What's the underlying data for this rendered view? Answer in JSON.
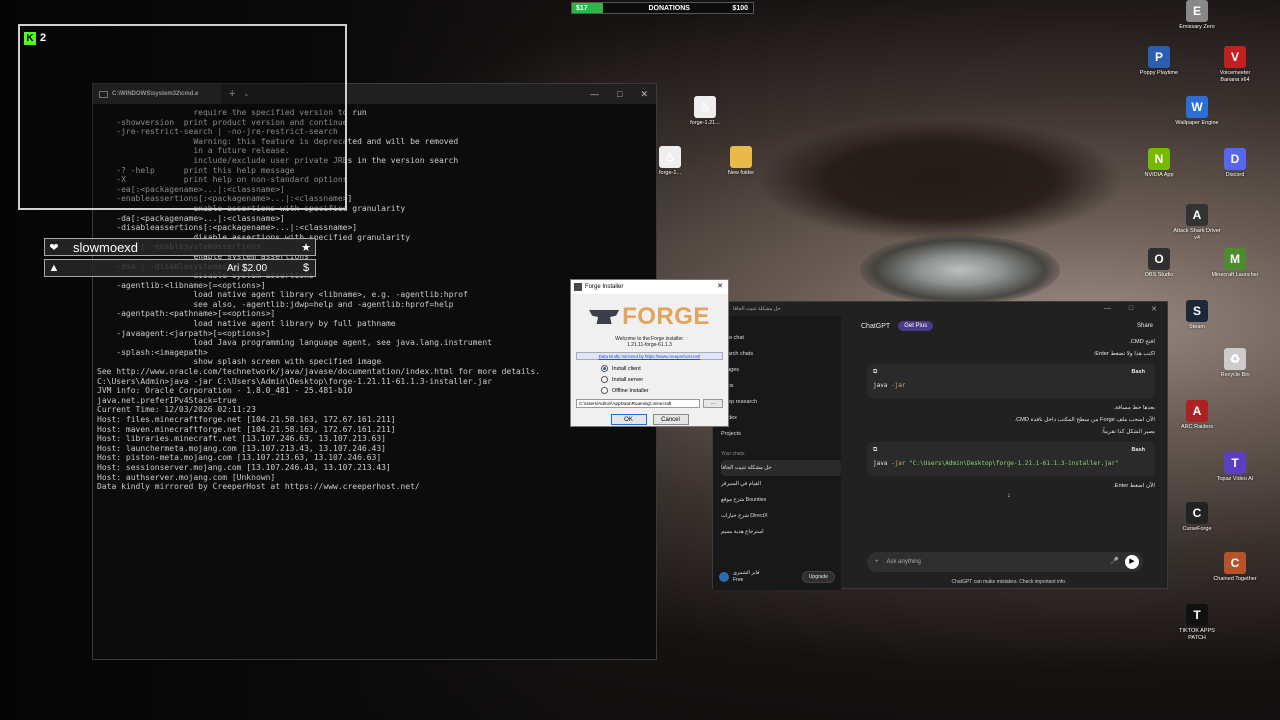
{
  "donation": {
    "current": "$17",
    "label": "DONATIONS",
    "goal": "$100",
    "progress": 0.17,
    "fill_color": "#2fb44a"
  },
  "kick": {
    "viewers": "2",
    "logo": "K"
  },
  "overlay_rows": [
    {
      "left_icon": "heart-icon",
      "text": "slowmoexd",
      "right_icon": "star-icon",
      "left_glyph": "❤",
      "right_glyph": "★"
    },
    {
      "left_icon": "drop-icon",
      "text": "Ari",
      "amount": "$2.00",
      "right_icon": "dollar-icon",
      "left_glyph": "▲",
      "right_glyph": "$"
    }
  ],
  "cmd": {
    "tab_title": "C:\\WINDOWS\\system32\\cmd.e",
    "plus": "+",
    "chevron": "⌄",
    "win_controls": [
      "—",
      "□",
      "✕"
    ],
    "lines": [
      "                    require the specified version to run",
      "    -showversion  print product version and continue",
      "    -jre-restrict-search | -no-jre-restrict-search",
      "                    Warning: this feature is deprecated and will be removed",
      "                    in a future release.",
      "                    include/exclude user private JREs in the version search",
      "    -? -help      print this help message",
      "    -X            print help on non-standard options",
      "    -ea[:<packagename>...|:<classname>]",
      "    -enableassertions[:<packagename>...|:<classname>]",
      "                    enable assertions with specified granularity",
      "    -da[:<packagename>...|:<classname>]",
      "    -disableassertions[:<packagename>...|:<classname>]",
      "                    disable assertions with specified granularity",
      "    -esa | -enablesystemassertions",
      "                    enable system assertions",
      "    -dsa | -disablesystemassertions",
      "                    disable system assertions",
      "    -agentlib:<libname>[=<options>]",
      "                    load native agent library <libname>, e.g. -agentlib:hprof",
      "                    see also, -agentlib:jdwp=help and -agentlib:hprof=help",
      "    -agentpath:<pathname>[=<options>]",
      "                    load native agent library by full pathname",
      "    -javaagent:<jarpath>[=<options>]",
      "                    load Java programming language agent, see java.lang.instrument",
      "    -splash:<imagepath>",
      "                    show splash screen with specified image",
      "See http://www.oracle.com/technetwork/java/javase/documentation/index.html for more details.",
      "",
      "C:\\Users\\Admin>java -jar C:\\Users\\Admin\\Desktop\\forge-1.21.11-61.1.3-installer.jar",
      "JVM info: Oracle Corporation - 1.8.0_481 - 25.481-b10",
      "java.net.preferIPv4Stack=true",
      "Current Time: 12/03/2026 02:11:23",
      "Host: files.minecraftforge.net [104.21.58.163, 172.67.161.211]",
      "Host: maven.minecraftforge.net [104.21.58.163, 172.67.161.211]",
      "Host: libraries.minecraft.net [13.107.246.63, 13.107.213.63]",
      "Host: launchermeta.mojang.com [13.107.213.43, 13.107.246.43]",
      "Host: piston-meta.mojang.com [13.107.213.63, 13.107.246.63]",
      "Host: sessionserver.mojang.com [13.107.246.43, 13.107.213.43]",
      "Host: authserver.mojang.com [Unknown]",
      "Data kindly mirrored by CreeperHost at https://www.creeperhost.net/"
    ]
  },
  "desktop_icons": [
    {
      "label": "Emissary Zero",
      "icon": "emissary-icon",
      "color": "#888",
      "glyph": "E"
    },
    {
      "label": "Poppy Playtime",
      "icon": "poppy-icon",
      "color": "#2a5fb0",
      "glyph": "P"
    },
    {
      "label": "Voicemeeter Banana x64",
      "icon": "voicemeeter-icon",
      "color": "#c02020",
      "glyph": "V"
    },
    {
      "label": "Wallpaper Engine",
      "icon": "wallpaper-engine-icon",
      "color": "#2c6ed5",
      "glyph": "W"
    },
    {
      "label": "NVIDIA App",
      "icon": "nvidia-icon",
      "color": "#76b900",
      "glyph": "N"
    },
    {
      "label": "Discord",
      "icon": "discord-icon",
      "color": "#5865f2",
      "glyph": "D"
    },
    {
      "label": "Attack Shark Driver v4",
      "icon": "attack-shark-icon",
      "color": "#333",
      "glyph": "A"
    },
    {
      "label": "OBS Studio",
      "icon": "obs-icon",
      "color": "#302e31",
      "glyph": "O"
    },
    {
      "label": "Minecraft Launcher",
      "icon": "minecraft-icon",
      "color": "#4d8c2e",
      "glyph": "M"
    },
    {
      "label": "Steam",
      "icon": "steam-icon",
      "color": "#1b2838",
      "glyph": "S"
    },
    {
      "label": "Recycle Bin",
      "icon": "recycle-bin-icon",
      "color": "#ccc",
      "glyph": "♻"
    },
    {
      "label": "ARC Raiders",
      "icon": "arc-raiders-icon",
      "color": "#a22",
      "glyph": "A"
    },
    {
      "label": "Topaz Video AI",
      "icon": "topaz-icon",
      "color": "#5a3fc0",
      "glyph": "T"
    },
    {
      "label": "CurseForge",
      "icon": "curseforge-icon",
      "color": "#222",
      "glyph": "C"
    },
    {
      "label": "Chained Together",
      "icon": "chained-together-icon",
      "color": "#b5542a",
      "glyph": "C"
    },
    {
      "label": "TIKTOK APPS PATCH",
      "icon": "tiktok-icon",
      "color": "#111",
      "glyph": "T"
    },
    {
      "label": "forge-1.21...",
      "icon": "java-icon",
      "color": "#eee",
      "glyph": "♨"
    },
    {
      "label": "forge-1...",
      "icon": "java-icon-2",
      "color": "#eee",
      "glyph": "♨"
    },
    {
      "label": "New folder",
      "icon": "folder-icon",
      "color": "#e9b949",
      "glyph": ""
    }
  ],
  "forge": {
    "title": "Forge Installer",
    "close": "✕",
    "logo_text": "FORGE",
    "welcome": "Welcome to the Forge installer.",
    "version": "1.21.11-forge-61.1.3",
    "mirror": "Data kindly mirrored by https://www.creeperhost.net/",
    "options": [
      {
        "label": "Install client",
        "selected": true
      },
      {
        "label": "Install server",
        "selected": false
      },
      {
        "label": "Offline Installer",
        "selected": false
      }
    ],
    "path": "C:\\Users\\Admin\\AppData\\Roaming\\.minecraft",
    "browse": "...",
    "ok": "OK",
    "cancel": "Cancel"
  },
  "chatgpt": {
    "window_title": "حل مشكلة تثبيت الجافا",
    "win_controls": [
      "—",
      "□",
      "✕"
    ],
    "sidebar_items": [
      "New chat",
      "Search chats",
      "Images",
      "Apps",
      "Deep research",
      "Codex",
      "Projects"
    ],
    "your_chats_label": "Your chats",
    "chats": [
      "حل مشكلة تثبيت الجافا",
      "القيام في السيرفر",
      "Bounties شرح موقع",
      "DirectX شرح خيارات",
      "استرجاع هدية بسيم"
    ],
    "user_name": "فايز الشمري",
    "user_plan": "Free",
    "upgrade": "Upgrade",
    "model": "ChatGPT",
    "get_plus": "Get Plus",
    "share": "Share",
    "messages": [
      "افتح CMD.",
      "اكتب هذا ولا تضغط Enter:"
    ],
    "code1_lang": "Bash",
    "code1_cmd": "java",
    "code1_arg": "-jar",
    "messages2": [
      "بعدها حط مسافة.",
      "الآن اسحب ملف Forge من سطح المكتب داخل نافذة CMD.",
      "يصير الشكل كذا تقريباً:"
    ],
    "code2_lang": "Bash",
    "code2_cmd": "java",
    "code2_arg": "-jar",
    "code2_str": "\"C:\\Users\\Admin\\Desktop\\forge-1.21.1-61.1.3-installer.jar\"",
    "last_message": "الآن اضغط Enter.",
    "scroll_down": "↓",
    "input_placeholder": "Ask anything",
    "disclaimer": "ChatGPT can make mistakes. Check important info."
  }
}
